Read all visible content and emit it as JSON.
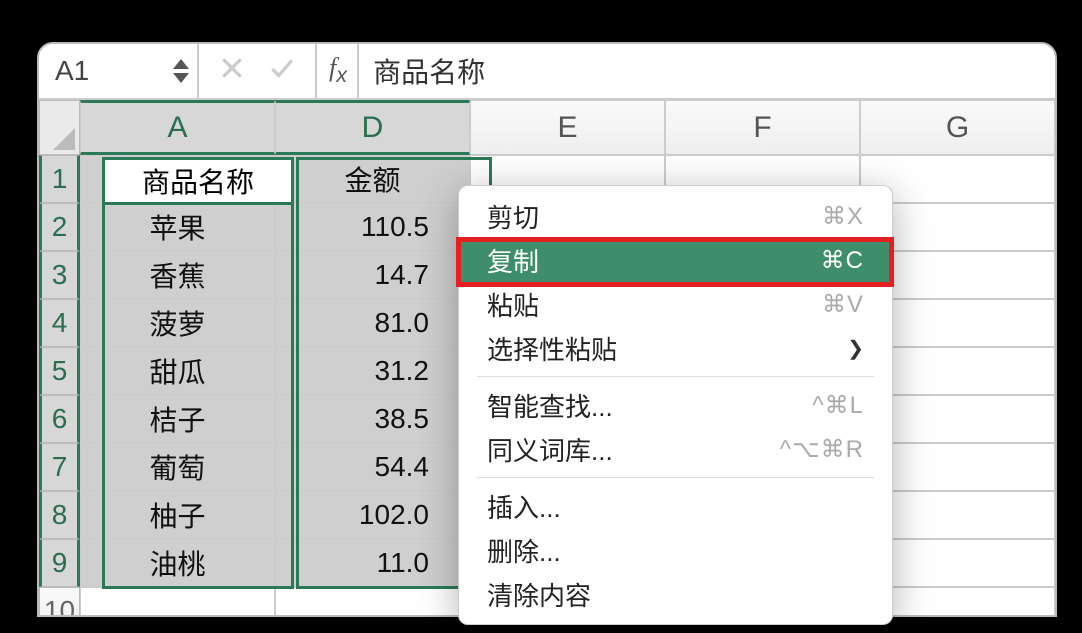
{
  "name_box": "A1",
  "formula_value": "商品名称",
  "columns": [
    "A",
    "D",
    "E",
    "F",
    "G"
  ],
  "selected_columns": [
    "A",
    "D"
  ],
  "rows": [
    {
      "n": 1,
      "a": "商品名称",
      "d": "金额",
      "a_align": "center",
      "d_align": "center"
    },
    {
      "n": 2,
      "a": "苹果",
      "d": "110.5",
      "a_align": "center",
      "d_align": "right"
    },
    {
      "n": 3,
      "a": "香蕉",
      "d": "14.7",
      "a_align": "center",
      "d_align": "right"
    },
    {
      "n": 4,
      "a": "菠萝",
      "d": "81.0",
      "a_align": "center",
      "d_align": "right"
    },
    {
      "n": 5,
      "a": "甜瓜",
      "d": "31.2",
      "a_align": "center",
      "d_align": "right"
    },
    {
      "n": 6,
      "a": "桔子",
      "d": "38.5",
      "a_align": "center",
      "d_align": "right"
    },
    {
      "n": 7,
      "a": "葡萄",
      "d": "54.4",
      "a_align": "center",
      "d_align": "right"
    },
    {
      "n": 8,
      "a": "柚子",
      "d": "102.0",
      "a_align": "center",
      "d_align": "right"
    },
    {
      "n": 9,
      "a": "油桃",
      "d": "11.0",
      "a_align": "center",
      "d_align": "right"
    },
    {
      "n": 10,
      "a": "",
      "d": "",
      "a_align": "center",
      "d_align": "right"
    }
  ],
  "context_menu": {
    "groups": [
      [
        {
          "label": "剪切",
          "shortcut": "⌘X",
          "highlighted": false
        },
        {
          "label": "复制",
          "shortcut": "⌘C",
          "highlighted": true
        },
        {
          "label": "粘贴",
          "shortcut": "⌘V",
          "highlighted": false
        },
        {
          "label": "选择性粘贴",
          "submenu": true
        }
      ],
      [
        {
          "label": "智能查找...",
          "shortcut": "^⌘L"
        },
        {
          "label": "同义词库...",
          "shortcut": "^⌥⌘R"
        }
      ],
      [
        {
          "label": "插入..."
        },
        {
          "label": "删除..."
        },
        {
          "label": "清除内容"
        }
      ]
    ]
  }
}
